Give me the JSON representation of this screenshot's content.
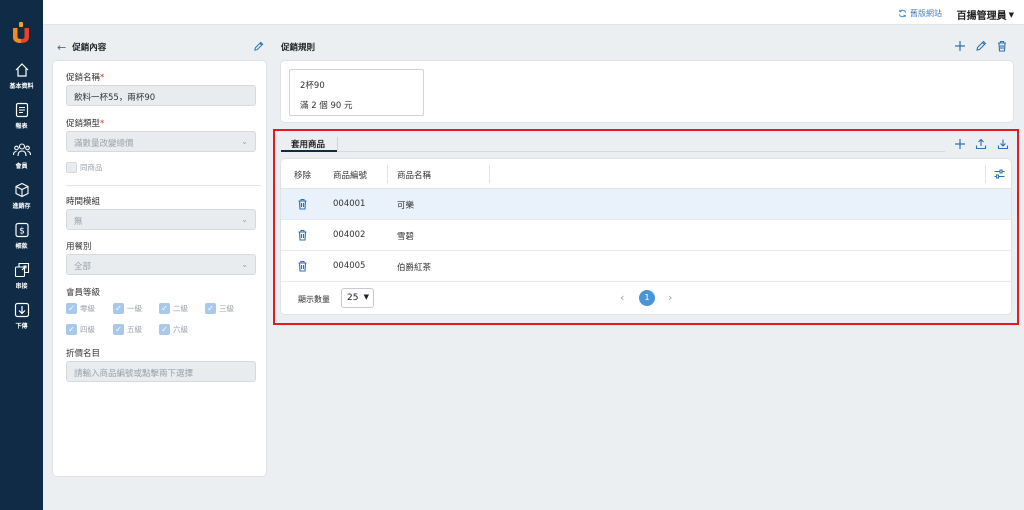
{
  "sidebar": {
    "items": [
      {
        "label": "基本資料",
        "icon": "home-icon"
      },
      {
        "label": "報表",
        "icon": "report-icon"
      },
      {
        "label": "會員",
        "icon": "members-icon"
      },
      {
        "label": "進銷存",
        "icon": "inventory-icon"
      },
      {
        "label": "帳款",
        "icon": "billing-icon"
      },
      {
        "label": "串接",
        "icon": "integration-icon"
      },
      {
        "label": "下傳",
        "icon": "download-icon"
      }
    ]
  },
  "topbar": {
    "old_site_label": "舊版網站",
    "user_label": "百揚管理員"
  },
  "left": {
    "title": "促銷內容",
    "promo_name_label": "促銷名稱",
    "promo_name_value": "飲料一杯55，兩杯90",
    "promo_type_label": "促銷類型",
    "promo_type_value": "滿數量改變總價",
    "same_item_label": "同商品",
    "time_module_label": "時間模組",
    "time_module_value": "無",
    "meal_type_label": "用餐別",
    "meal_type_value": "全部",
    "member_level_label": "會員等級",
    "member_levels": [
      "零級",
      "一級",
      "二級",
      "三級",
      "四級",
      "五級",
      "六級"
    ],
    "discount_list_label": "折價名目",
    "discount_placeholder": "請輸入商品編號或點擊兩下選擇"
  },
  "rules": {
    "title": "促銷規則",
    "card_line1": "2杯90",
    "card_line2": "滿 2 個 90 元"
  },
  "products": {
    "tab_label": "套用商品",
    "columns": [
      "移除",
      "商品編號",
      "商品名稱"
    ],
    "rows": [
      {
        "code": "004001",
        "name": "可樂"
      },
      {
        "code": "004002",
        "name": "雪碧"
      },
      {
        "code": "004005",
        "name": "伯爵紅茶"
      }
    ],
    "page_size_label": "顯示數量",
    "page_size_value": "25",
    "current_page": "1"
  },
  "colors": {
    "sidebar_bg": "#0f2b46",
    "accent": "#2f6fb3",
    "highlight": "#e11b22"
  }
}
